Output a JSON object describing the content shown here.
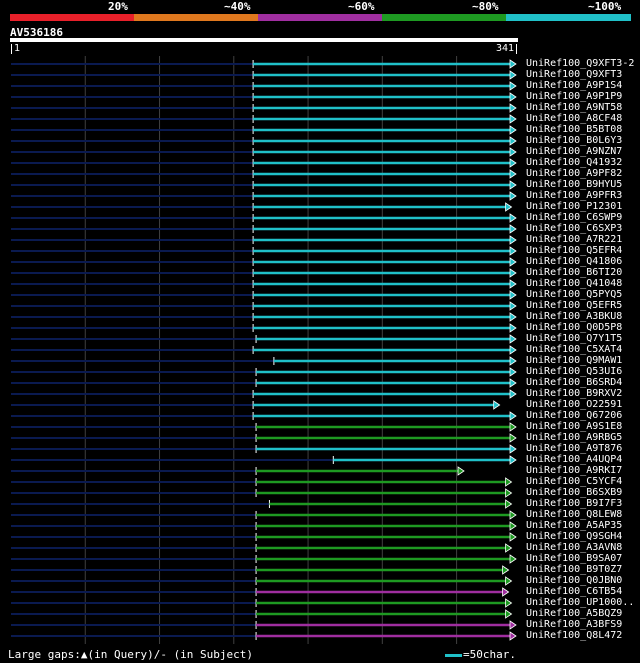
{
  "legend": {
    "items": [
      {
        "label": "20%",
        "color": "#e8202a"
      },
      {
        "label": "~40%",
        "color": "#e0781e"
      },
      {
        "label": "~60%",
        "color": "#a02ea0"
      },
      {
        "label": "~80%",
        "color": "#1e9a22"
      },
      {
        "label": "~100%",
        "color": "#20c0c8"
      }
    ]
  },
  "query": {
    "name": "AV536186",
    "start": "1",
    "end": "341"
  },
  "colors": {
    "left_overhang": "#0a1a50",
    "grid": "#404040",
    "cyan": "#20c0c8",
    "green": "#1e9a22",
    "purple": "#a02ea0"
  },
  "hits": [
    {
      "id": "UniRef100_Q9XFT3-2",
      "color": "cyan",
      "start": 164,
      "end": 341
    },
    {
      "id": "UniRef100_Q9XFT3",
      "color": "cyan",
      "start": 164,
      "end": 341
    },
    {
      "id": "UniRef100_A9P1S4",
      "color": "cyan",
      "start": 164,
      "end": 341
    },
    {
      "id": "UniRef100_A9P1P9",
      "color": "cyan",
      "start": 164,
      "end": 341
    },
    {
      "id": "UniRef100_A9NT58",
      "color": "cyan",
      "start": 164,
      "end": 341
    },
    {
      "id": "UniRef100_A8CF48",
      "color": "cyan",
      "start": 164,
      "end": 341
    },
    {
      "id": "UniRef100_B5BT08",
      "color": "cyan",
      "start": 164,
      "end": 341
    },
    {
      "id": "UniRef100_B0L6Y3",
      "color": "cyan",
      "start": 164,
      "end": 341
    },
    {
      "id": "UniRef100_A9NZN7",
      "color": "cyan",
      "start": 164,
      "end": 341
    },
    {
      "id": "UniRef100_Q41932",
      "color": "cyan",
      "start": 164,
      "end": 341
    },
    {
      "id": "UniRef100_A9PF82",
      "color": "cyan",
      "start": 164,
      "end": 341
    },
    {
      "id": "UniRef100_B9HYU5",
      "color": "cyan",
      "start": 164,
      "end": 341
    },
    {
      "id": "UniRef100_A9PFR3",
      "color": "cyan",
      "start": 164,
      "end": 341
    },
    {
      "id": "UniRef100_P12301",
      "color": "cyan",
      "start": 164,
      "end": 338
    },
    {
      "id": "UniRef100_C6SWP9",
      "color": "cyan",
      "start": 164,
      "end": 341
    },
    {
      "id": "UniRef100_C6SXP3",
      "color": "cyan",
      "start": 164,
      "end": 341
    },
    {
      "id": "UniRef100_A7R221",
      "color": "cyan",
      "start": 164,
      "end": 341
    },
    {
      "id": "UniRef100_Q5EFR4",
      "color": "cyan",
      "start": 164,
      "end": 341
    },
    {
      "id": "UniRef100_Q41806",
      "color": "cyan",
      "start": 164,
      "end": 341
    },
    {
      "id": "UniRef100_B6TI20",
      "color": "cyan",
      "start": 164,
      "end": 341
    },
    {
      "id": "UniRef100_Q41048",
      "color": "cyan",
      "start": 164,
      "end": 341
    },
    {
      "id": "UniRef100_Q5PYQ5",
      "color": "cyan",
      "start": 164,
      "end": 341
    },
    {
      "id": "UniRef100_Q5EFR5",
      "color": "cyan",
      "start": 164,
      "end": 341
    },
    {
      "id": "UniRef100_A3BKU8",
      "color": "cyan",
      "start": 164,
      "end": 341
    },
    {
      "id": "UniRef100_Q0D5P8",
      "color": "cyan",
      "start": 164,
      "end": 341
    },
    {
      "id": "UniRef100_Q7Y1T5",
      "color": "cyan",
      "start": 166,
      "end": 341
    },
    {
      "id": "UniRef100_C5XAT4",
      "color": "cyan",
      "start": 164,
      "end": 341
    },
    {
      "id": "UniRef100_Q9MAW1",
      "color": "cyan",
      "start": 178,
      "end": 341
    },
    {
      "id": "UniRef100_Q53UI6",
      "color": "cyan",
      "start": 166,
      "end": 341
    },
    {
      "id": "UniRef100_B6SRD4",
      "color": "cyan",
      "start": 166,
      "end": 341
    },
    {
      "id": "UniRef100_B9RXV2",
      "color": "cyan",
      "start": 164,
      "end": 341
    },
    {
      "id": "UniRef100_O22591",
      "color": "cyan",
      "start": 164,
      "end": 330
    },
    {
      "id": "UniRef100_Q67206",
      "color": "cyan",
      "start": 164,
      "end": 341
    },
    {
      "id": "UniRef100_A9S1E8",
      "color": "green",
      "start": 166,
      "end": 341
    },
    {
      "id": "UniRef100_A9RBG5",
      "color": "green",
      "start": 166,
      "end": 341
    },
    {
      "id": "UniRef100_A9T876",
      "color": "cyan",
      "start": 166,
      "end": 341
    },
    {
      "id": "UniRef100_A4UQP4",
      "color": "cyan",
      "start": 218,
      "end": 341
    },
    {
      "id": "UniRef100_A9RKI7",
      "color": "green",
      "start": 166,
      "end": 306
    },
    {
      "id": "UniRef100_C5YCF4",
      "color": "green",
      "start": 166,
      "end": 338
    },
    {
      "id": "UniRef100_B6SXB9",
      "color": "green",
      "start": 166,
      "end": 338
    },
    {
      "id": "UniRef100_B9I7F3",
      "color": "green",
      "start": 175,
      "end": 338
    },
    {
      "id": "UniRef100_Q8LEW8",
      "color": "green",
      "start": 166,
      "end": 341
    },
    {
      "id": "UniRef100_A5AP35",
      "color": "green",
      "start": 166,
      "end": 341
    },
    {
      "id": "UniRef100_Q9SGH4",
      "color": "green",
      "start": 166,
      "end": 341
    },
    {
      "id": "UniRef100_A3AVN8",
      "color": "green",
      "start": 166,
      "end": 338
    },
    {
      "id": "UniRef100_B9SA07",
      "color": "green",
      "start": 166,
      "end": 341
    },
    {
      "id": "UniRef100_B9T0Z7",
      "color": "green",
      "start": 166,
      "end": 336
    },
    {
      "id": "UniRef100_Q0JBN0",
      "color": "green",
      "start": 166,
      "end": 338
    },
    {
      "id": "UniRef100_C6TB54",
      "color": "purple",
      "start": 166,
      "end": 336
    },
    {
      "id": "UniRef100_UP1000..",
      "color": "green",
      "start": 166,
      "end": 338
    },
    {
      "id": "UniRef100_A5BQZ9",
      "color": "green",
      "start": 166,
      "end": 338
    },
    {
      "id": "UniRef100_A3BFS9",
      "color": "purple",
      "start": 166,
      "end": 341
    },
    {
      "id": "UniRef100_Q8L472",
      "color": "purple",
      "start": 166,
      "end": 341
    }
  ],
  "footer": {
    "text": "Large gaps:▲(in Query)/- (in Subject)",
    "scale_label": "=50char."
  }
}
